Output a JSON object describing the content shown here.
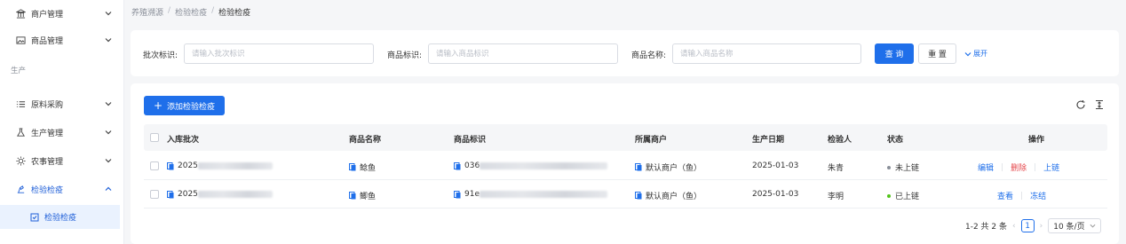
{
  "sidebar": {
    "items": [
      {
        "label": "商户管理",
        "icon": "bank-icon"
      },
      {
        "label": "商品管理",
        "icon": "image-icon"
      },
      {
        "label": "原料采购",
        "icon": "list-icon"
      },
      {
        "label": "生产管理",
        "icon": "flask-icon"
      },
      {
        "label": "农事管理",
        "icon": "sun-icon"
      },
      {
        "label": "检验检疫",
        "icon": "inspect-icon"
      }
    ],
    "group_label": "生产",
    "sub_item": "检验检疫"
  },
  "breadcrumb": [
    "养殖溯源",
    "检验检疫",
    "检验检疫"
  ],
  "search": {
    "batch_label": "批次标识:",
    "batch_placeholder": "请输入批次标识",
    "goods_id_label": "商品标识:",
    "goods_id_placeholder": "请输入商品标识",
    "goods_name_label": "商品名称:",
    "goods_name_placeholder": "请输入商品名称",
    "query_button": "查 询",
    "reset_button": "重 置",
    "expand_link": "展开"
  },
  "table": {
    "add_button": "添加检验检疫",
    "columns": [
      "入库批次",
      "商品名称",
      "商品标识",
      "所属商户",
      "生产日期",
      "检验人",
      "状态",
      "操作"
    ],
    "rows": [
      {
        "batch": "2025",
        "name": "鲶鱼",
        "goods_id": "036",
        "merchant": "默认商户（鱼）",
        "date": "2025-01-03",
        "inspector": "朱青",
        "status": "未上链",
        "status_color": "#8a8f99",
        "actions": [
          "编辑",
          "删除",
          "上链"
        ]
      },
      {
        "batch": "2025",
        "name": "鲫鱼",
        "goods_id": "91e",
        "merchant": "默认商户（鱼）",
        "date": "2025-01-03",
        "inspector": "李明",
        "status": "已上链",
        "status_color": "#52c41a",
        "actions": [
          "查看",
          "冻结"
        ]
      }
    ]
  },
  "pagination": {
    "summary": "1-2 共 2 条",
    "current_page": "1",
    "page_size": "10 条/页"
  },
  "colors": {
    "primary": "#1f6fea",
    "danger": "#e5484d",
    "success": "#52c41a"
  }
}
